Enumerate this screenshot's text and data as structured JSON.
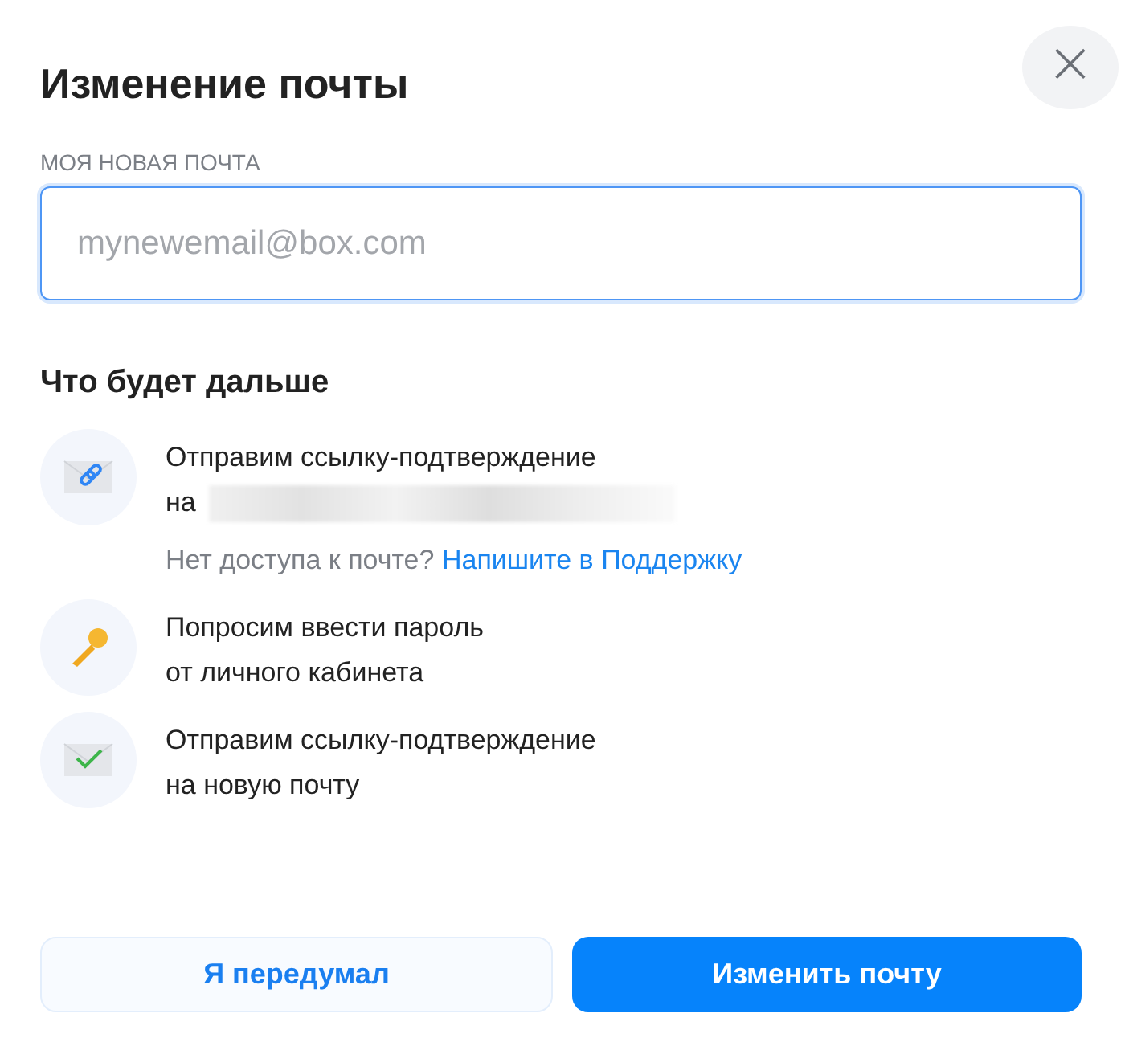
{
  "dialog": {
    "title": "Изменение почты",
    "close": "×"
  },
  "field": {
    "label": "МОЯ НОВАЯ ПОЧТА",
    "placeholder": "mynewemail@box.com"
  },
  "steps_title": "Что будет дальше",
  "steps": [
    {
      "kind": "link-mail",
      "lines": [
        "Отправим ссылку-подтверждение",
        "на"
      ],
      "redacted": true,
      "note": "Нет доступа к почте?",
      "link": "Напишите в Поддержку"
    },
    {
      "kind": "key",
      "lines": [
        "Попросим ввести пароль",
        "от личного кабинета"
      ]
    },
    {
      "kind": "check-mail",
      "lines": [
        "Отправим ссылку-подтверждение",
        "на новую почту"
      ]
    }
  ],
  "buttons": [
    {
      "label": "Я передумал",
      "kind": "secondary"
    },
    {
      "label": "Изменить почту",
      "kind": "primary"
    }
  ]
}
